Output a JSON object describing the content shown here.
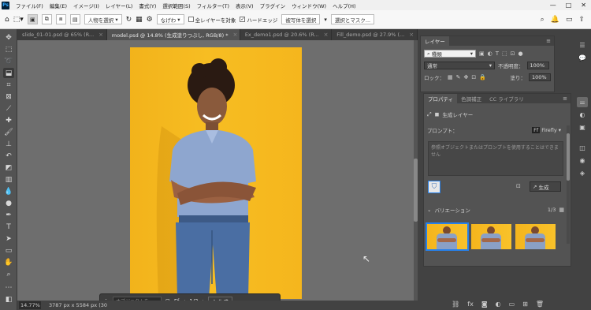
{
  "app": {
    "logo": "Ps"
  },
  "menu": [
    "ファイル(F)",
    "編集(E)",
    "イメージ(I)",
    "レイヤー(L)",
    "書式(Y)",
    "選択範囲(S)",
    "フィルター(T)",
    "表示(V)",
    "プラグイン",
    "ウィンドウ(W)",
    "ヘルプ(H)"
  ],
  "window_controls": [
    "—",
    "□",
    "✕"
  ],
  "options": {
    "subject_select": "人物を選択",
    "blur_select": "なげわ",
    "all_layers_label": "全レイヤーを対象",
    "hard_edge_label": "ハードエッジ",
    "select_subject_btn": "被写体を選択",
    "select_mask_btn": "選択とマスク..."
  },
  "tabs": [
    {
      "label": "slide_01-01.psd @ 65% (R...",
      "active": false
    },
    {
      "label": "model.psd @ 14.8% (生成塗りつぶし, RGB/8) *",
      "active": true
    },
    {
      "label": "Ex_demo1.psd @ 20.6% (R...",
      "active": false
    },
    {
      "label": "Fill_demo.psd @ 27.9% (...",
      "active": false
    }
  ],
  "layers_panel": {
    "tab": "レイヤー",
    "kind_label": "種類",
    "blend_mode": "通常",
    "opacity_label": "不透明度：",
    "opacity_value": "100%",
    "lock_label": "ロック：",
    "fill_label": "塗り：",
    "fill_value": "100%"
  },
  "properties_panel": {
    "tabs": [
      "プロパティ",
      "色調補正",
      "CC ライブラリ"
    ],
    "layer_type": "生成レイヤー",
    "prompt_label": "プロンプト：",
    "model_label": "Firefly",
    "prompt_placeholder": "参照オブジェクトまたはプロンプトを使用することはできません",
    "generate_label": "生成",
    "variations_label": "バリエーション",
    "variations_count": "1/3"
  },
  "taskbar": {
    "placeholder": "オブジェクトを...",
    "page": "1/3",
    "generate_label": "生成"
  },
  "status": {
    "zoom": "14.77%",
    "dimensions": "3787 px x 5584 px (30"
  },
  "colors": {
    "accent": "#2680eb",
    "photo_bg": "#f5b61d",
    "canvas_bg": "#6e6e6e"
  }
}
